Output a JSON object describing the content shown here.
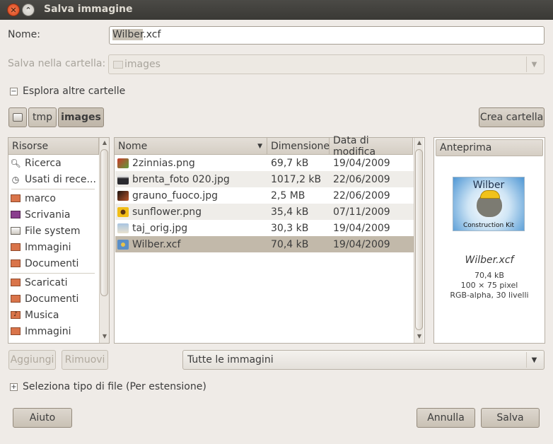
{
  "window": {
    "title": "Salva immagine"
  },
  "name_label": "Nome:",
  "name_value_selected": "Wilber",
  "name_value_ext": ".xcf",
  "folder_label": "Salva nella cartella:",
  "folder_value": "images",
  "browse_expander": "Esplora altre cartelle",
  "path_buttons": [
    "tmp",
    "images"
  ],
  "create_folder": "Crea cartella",
  "sidebar": {
    "header": "Risorse",
    "items": [
      {
        "label": "Ricerca",
        "icon": "search-icon"
      },
      {
        "label": "Usati di rece...",
        "icon": "recent-icon"
      },
      {
        "label": "marco",
        "icon": "home-folder-icon"
      },
      {
        "label": "Scrivania",
        "icon": "desktop-icon"
      },
      {
        "label": "File system",
        "icon": "drive-icon"
      },
      {
        "label": "Immagini",
        "icon": "folder-icon"
      },
      {
        "label": "Documenti",
        "icon": "folder-icon"
      },
      {
        "label": "Scaricati",
        "icon": "folder-icon"
      },
      {
        "label": "Documenti",
        "icon": "folder-icon"
      },
      {
        "label": "Musica",
        "icon": "music-folder-icon"
      },
      {
        "label": "Immagini",
        "icon": "folder-icon"
      }
    ]
  },
  "files": {
    "columns": [
      "Nome",
      "Dimensione",
      "Data di modifica"
    ],
    "rows": [
      {
        "name": "2zinnias.png",
        "size": "69,7 kB",
        "date": "19/04/2009",
        "thumb": "#b84b3a"
      },
      {
        "name": "brenta_foto 020.jpg",
        "size": "1017,2 kB",
        "date": "22/06/2009",
        "thumb": "#3a3b3f"
      },
      {
        "name": "grauno_fuoco.jpg",
        "size": "2,5 MB",
        "date": "22/06/2009",
        "thumb": "#5b3424"
      },
      {
        "name": "sunflower.png",
        "size": "35,4 kB",
        "date": "07/11/2009",
        "thumb": "#e3b21c"
      },
      {
        "name": "taj_orig.jpg",
        "size": "30,3 kB",
        "date": "19/04/2009",
        "thumb": "#b6c9dc"
      },
      {
        "name": "Wilber.xcf",
        "size": "70,4 kB",
        "date": "19/04/2009",
        "thumb": "#7aa9d6"
      }
    ]
  },
  "preview": {
    "header": "Anteprima",
    "image_text_top": "Wilber",
    "image_text_bottom": "Construction Kit",
    "filename": "Wilber.xcf",
    "size": "70,4 kB",
    "dimensions": "100 × 75 pixel",
    "info": "RGB-alpha, 30 livelli"
  },
  "add_button": "Aggiungi",
  "remove_button": "Rimuovi",
  "filter_value": "Tutte le immagini",
  "filetype_expander": "Seleziona tipo di file (Per estensione)",
  "help_button": "Aiuto",
  "cancel_button": "Annulla",
  "save_button": "Salva"
}
